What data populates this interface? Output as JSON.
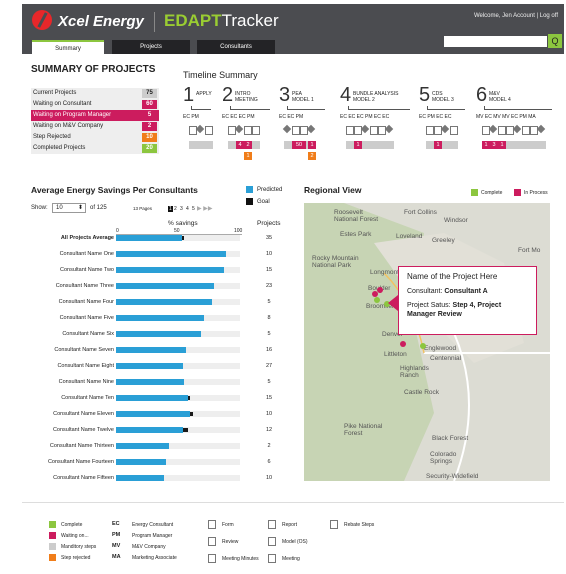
{
  "header": {
    "brand": "Xcel Energy",
    "app_prefix": "EDAPT",
    "app_suffix": "racker",
    "user_links": "Welcome, Jen   Account   |  Log off",
    "search_button": "Q"
  },
  "tabs": [
    {
      "label": "Summary"
    },
    {
      "label": "Projects"
    },
    {
      "label": "Consultants"
    }
  ],
  "summary": {
    "title": "SUMMARY OF PROJECTS",
    "rows": [
      {
        "label": "Current Projects",
        "value": "75",
        "color": "#cccccc",
        "dark": true
      },
      {
        "label": "Waiting on Consultant",
        "value": "60",
        "color": "#cc1c5e"
      },
      {
        "label": "Waiting on Program Manager",
        "value": "5",
        "color": "#cc1c5e",
        "highlight": true
      },
      {
        "label": "Waiting on M&V Company",
        "value": "2",
        "color": "#cc1c5e"
      },
      {
        "label": "Step Rejected",
        "value": "10",
        "color": "#f07d1a"
      },
      {
        "label": "Completed Projects",
        "value": "20",
        "color": "#8cc63f"
      }
    ]
  },
  "timeline": {
    "title": "Timeline Summary",
    "steps": [
      {
        "num": "1",
        "label": "APPLY",
        "roles": "EC PM"
      },
      {
        "num": "2",
        "label": "INTRO\nMEETING",
        "roles": "EC  EC  EC  PM"
      },
      {
        "num": "3",
        "label": "PEA\nMODEL 1",
        "roles": "EC  EC  PM"
      },
      {
        "num": "4",
        "label": "BUNDLE ANALYSIS\nMODEL 2",
        "roles": "EC  EC  EC  PM  EC  EC"
      },
      {
        "num": "5",
        "label": "CDS\nMODEL 3",
        "roles": "EC  PM  EC  EC"
      },
      {
        "num": "6",
        "label": "M&V\nMODEL 4",
        "roles": "MV  EC  MV  MV  EC  PM  MA"
      }
    ],
    "badges": [
      "4",
      "2",
      "1",
      "50",
      "1",
      "2",
      "1",
      "1",
      "1",
      "3",
      "1"
    ]
  },
  "savings": {
    "title": "Average Energy Savings Per Consultants",
    "show_label": "Show:",
    "show_value": "10",
    "of_label": "of 125",
    "pages_label": "13 Pages",
    "pages": [
      "1",
      "2",
      "3",
      "4",
      "5"
    ],
    "legend": [
      "Predicted",
      "Goal"
    ],
    "col_savings": "% savings",
    "col_projects": "Projects",
    "axis": [
      "0",
      "50",
      "100"
    ]
  },
  "chart_data": {
    "type": "bar",
    "categories": [
      "All Projects Average",
      "Consultant Name One",
      "Consultant Name Two",
      "Consultant Name Three",
      "Consultant Name Four",
      "Consultant Name Five",
      "Consultant Name Six",
      "Consultant Name Seven",
      "Consultant Name Eight",
      "Consultant Name Nine",
      "Consultant Name Ten",
      "Consultant Name Eleven",
      "Consultant Name Twelve",
      "Consultant Name Thirteen",
      "Consultant Name Fourteen",
      "Consultant Name Fifteen"
    ],
    "series": [
      {
        "name": "Predicted",
        "values": [
          55,
          92,
          90,
          82,
          80,
          73,
          71,
          58,
          56,
          57,
          60,
          62,
          56,
          44,
          42,
          40
        ]
      },
      {
        "name": "Goal",
        "values": [
          57,
          92,
          90,
          82,
          80,
          73,
          71,
          58,
          56,
          57,
          62,
          64,
          60,
          44,
          42,
          40
        ]
      }
    ],
    "projects": [
      35,
      10,
      15,
      23,
      5,
      8,
      5,
      16,
      27,
      5,
      15,
      10,
      12,
      2,
      6,
      10
    ],
    "xlim": [
      0,
      100
    ]
  },
  "regional": {
    "title": "Regional View",
    "legend": [
      "Complete",
      "In Process"
    ],
    "labels": [
      "Roosevelt\nNational Forest",
      "Fort Collins",
      "Windsor",
      "Estes Park",
      "Loveland",
      "Greeley",
      "Rocky Mountain\nNational Park",
      "Fort Mo",
      "Longmont",
      "Boulder",
      "Broomfield",
      "Arv",
      "Denver",
      "Littleton",
      "Englewood",
      "Centennial",
      "Highlands\nRanch",
      "Castle Rock",
      "Pike National\nForest",
      "Black Forest",
      "Colorado\nSprings",
      "Security-Widefield"
    ]
  },
  "popup": {
    "title": "Name of the Project Here",
    "consultant_label": "Consultant:",
    "consultant": "Consultant A",
    "status_label": "Project Satus:",
    "status": "Step 4, Project Manager Review"
  },
  "legend": [
    {
      "label": "Complete",
      "color": "#8cc63f"
    },
    {
      "label": "Waiting on...",
      "color": "#cc1c5e"
    },
    {
      "label": "Manditory steps",
      "color": "#cccccc"
    },
    {
      "label": "Step rejected",
      "color": "#f07d1a"
    }
  ],
  "abbrev": [
    {
      "code": "EC",
      "text": "Energy Consultant"
    },
    {
      "code": "PM",
      "text": "Program Manager"
    },
    {
      "code": "MV",
      "text": "M&V Company"
    },
    {
      "code": "MA",
      "text": "Marketing Associate"
    }
  ],
  "icons": [
    {
      "name": "form-icon",
      "text": "Form"
    },
    {
      "name": "review-icon",
      "text": "Review"
    },
    {
      "name": "meeting-minutes-icon",
      "text": "Meeting Minutes"
    },
    {
      "name": "report-icon",
      "text": "Report"
    },
    {
      "name": "model-icon",
      "text": "Model (OS)"
    },
    {
      "name": "meeting-icon",
      "text": "Meeting"
    },
    {
      "name": "rebate-steps-icon",
      "text": "Rebate Steps"
    }
  ]
}
